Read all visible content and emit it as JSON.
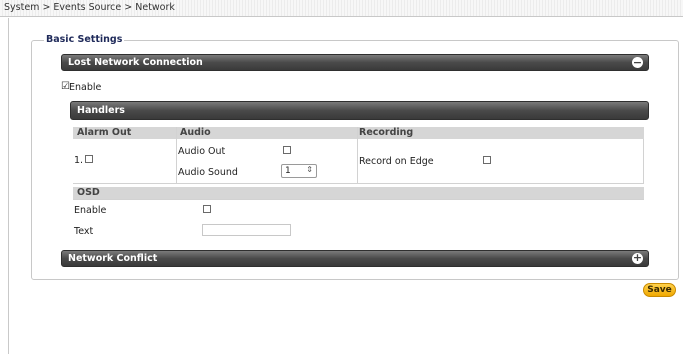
{
  "breadcrumb": "System > Events Source > Network",
  "section_legend": "Basic Settings",
  "lost_connection": {
    "title": "Lost Network Connection",
    "toggle": "−"
  },
  "enable_label": "Enable",
  "handlers": {
    "title": "Handlers"
  },
  "table": {
    "alarm_out": "Alarm Out",
    "audio": "Audio",
    "recording": "Recording",
    "row_index": "1.",
    "audio_out": "Audio Out",
    "audio_sound": "Audio Sound",
    "audio_sound_value": "1",
    "stepper_arrows": "⇕",
    "record_on_edge": "Record on Edge"
  },
  "osd": {
    "title": "OSD",
    "enable": "Enable",
    "text": "Text",
    "text_value": ""
  },
  "network_conflict": {
    "title": "Network Conflict",
    "toggle": "+"
  },
  "save_label": "Save"
}
